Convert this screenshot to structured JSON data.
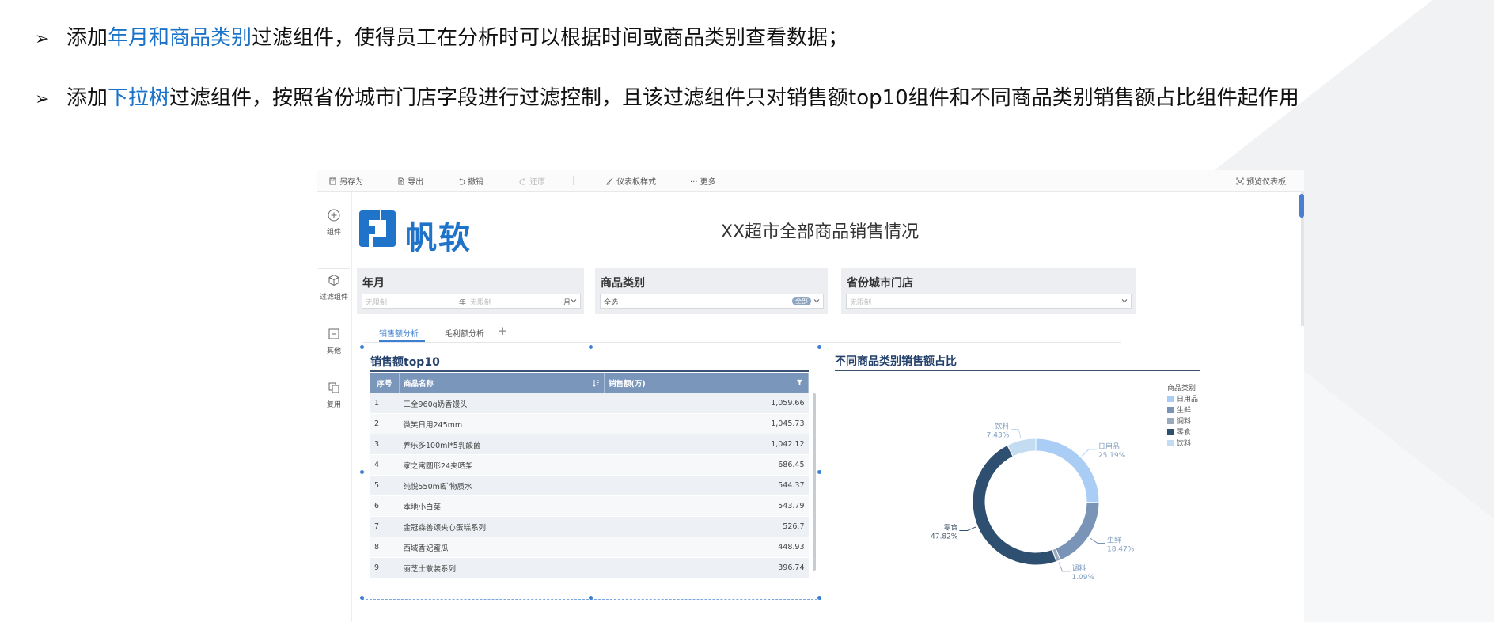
{
  "bullets": {
    "b1": {
      "pre": "添加",
      "highlight": "年月和商品类别",
      "post": "过滤组件，使得员工在分析时可以根据时间或商品类别查看数据；"
    },
    "b2": {
      "pre": "添加",
      "highlight": "下拉树",
      "post": "过滤组件，按照省份城市门店字段进行过滤控制，且该过滤组件只对销售额top10组件和不同商品类别销售额占比组件起作用"
    }
  },
  "toolbar": {
    "save_as": "另存为",
    "export": "导出",
    "undo": "撤销",
    "redo": "还原",
    "dashboard_style": "仪表板样式",
    "more": "更多",
    "preview": "预览仪表板"
  },
  "sidebar": {
    "items": [
      {
        "label": "组件",
        "icon": "plus-circle-icon"
      },
      {
        "label": "过滤组件",
        "icon": "cube-icon"
      },
      {
        "label": "其他",
        "icon": "text-box-icon"
      },
      {
        "label": "复用",
        "icon": "copy-icon"
      }
    ]
  },
  "logo": {
    "text": "帆软"
  },
  "dashboard": {
    "title": "XX超市全部商品销售情况"
  },
  "filters": {
    "year_month": {
      "title": "年月",
      "placeholder1": "无限制",
      "unit1": "年",
      "placeholder2": "无限制",
      "unit2": "月"
    },
    "category": {
      "title": "商品类别",
      "value": "全选",
      "tag": "全部"
    },
    "province": {
      "title": "省份城市门店",
      "placeholder": "无限制"
    }
  },
  "tabs": {
    "items": [
      "销售额分析",
      "毛利额分析"
    ],
    "add": "+"
  },
  "table_widget": {
    "title": "销售额top10",
    "columns": [
      "序号",
      "商品名称",
      "销售额(万)"
    ],
    "rows": [
      [
        "1",
        "三全960g奶香馒头",
        "1,059.66"
      ],
      [
        "2",
        "微笑日用245mm",
        "1,045.73"
      ],
      [
        "3",
        "养乐多100ml*5乳酸菌",
        "1,042.12"
      ],
      [
        "4",
        "家之寓圆形24夹晒架",
        "686.45"
      ],
      [
        "5",
        "纯悦550ml矿物质水",
        "544.37"
      ],
      [
        "6",
        "本地小白菜",
        "543.79"
      ],
      [
        "7",
        "金冠森善颂夹心蛋糕系列",
        "526.7"
      ],
      [
        "8",
        "西域香妃蜜瓜",
        "448.93"
      ],
      [
        "9",
        "丽芝士散装系列",
        "396.74"
      ]
    ]
  },
  "pie_widget": {
    "title": "不同商品类别销售额占比",
    "legend_title": "商品类别"
  },
  "chart_data": {
    "type": "pie",
    "title": "不同商品类别销售额占比",
    "legend_title": "商品类别",
    "legend_position": "top-right",
    "categories": [
      "日用品",
      "生鲜",
      "调料",
      "零食",
      "饮料"
    ],
    "values": [
      25.19,
      18.47,
      1.09,
      47.82,
      7.43
    ],
    "labels": [
      "25.19%",
      "18.47%",
      "1.09%",
      "47.82%",
      "7.43%"
    ],
    "colors": [
      "#a9cdf5",
      "#7a94b8",
      "#9aa9bc",
      "#2f4f70",
      "#c3dcf2"
    ]
  }
}
